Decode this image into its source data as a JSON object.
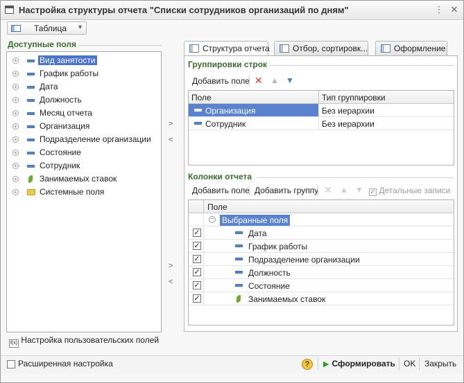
{
  "window": {
    "title": "Настройка структуры отчета \"Списки сотрудников организаций по дням\"",
    "menu_icon": "more-icon",
    "close_icon": "close-icon"
  },
  "view_mode": {
    "label": "Таблица",
    "icon": "table-icon"
  },
  "left": {
    "heading": "Доступные поля",
    "fields": [
      {
        "label": "Вид занятости",
        "icon": "field-icon",
        "expandable": true,
        "selected": true
      },
      {
        "label": "График работы",
        "icon": "field-icon",
        "expandable": true
      },
      {
        "label": "Дата",
        "icon": "field-icon",
        "expandable": true
      },
      {
        "label": "Должность",
        "icon": "field-icon",
        "expandable": true
      },
      {
        "label": "Месяц отчета",
        "icon": "field-icon",
        "expandable": true
      },
      {
        "label": "Организация",
        "icon": "field-icon",
        "expandable": true
      },
      {
        "label": "Подразделение организации",
        "icon": "field-icon",
        "expandable": true
      },
      {
        "label": "Состояние",
        "icon": "field-icon",
        "expandable": true
      },
      {
        "label": "Сотрудник",
        "icon": "field-icon",
        "expandable": true
      },
      {
        "label": "Занимаемых ставок",
        "icon": "resource-icon",
        "expandable": true
      },
      {
        "label": "Системные поля",
        "icon": "folder-icon",
        "expandable": true
      }
    ],
    "custom_fields_label": "Настройка пользовательских полей",
    "custom_fields_icon_text": "f(x)"
  },
  "transfer": {
    "add": ">",
    "remove": "<"
  },
  "tabs": [
    {
      "label": "Структура отчета",
      "active": true
    },
    {
      "label": "Отбор, сортировк..."
    },
    {
      "label": "Оформление"
    }
  ],
  "row_groups": {
    "heading": "Группировки строк",
    "add_field": "Добавить поле",
    "columns": [
      "Поле",
      "Тип группировки"
    ],
    "rows": [
      {
        "field": "Организация",
        "type": "Без иерархии",
        "selected": true
      },
      {
        "field": "Сотрудник",
        "type": "Без иерархии"
      }
    ]
  },
  "report_columns": {
    "heading": "Колонки отчета",
    "add_field": "Добавить поле",
    "add_group": "Добавить группу",
    "detail_records": "Детальные записи",
    "column_header": "Поле",
    "group_label": "Выбранные поля",
    "rows": [
      {
        "label": "Дата",
        "checked": true,
        "icon": "field-icon"
      },
      {
        "label": "График работы",
        "checked": true,
        "icon": "field-icon"
      },
      {
        "label": "Подразделение организации",
        "checked": true,
        "icon": "field-icon"
      },
      {
        "label": "Должность",
        "checked": true,
        "icon": "field-icon"
      },
      {
        "label": "Состояние",
        "checked": true,
        "icon": "field-icon"
      },
      {
        "label": "Занимаемых ставок",
        "checked": true,
        "icon": "resource-icon"
      }
    ]
  },
  "footer": {
    "extended": "Расширенная настройка",
    "help": "?",
    "generate": "Сформировать",
    "ok": "OK",
    "close": "Закрыть"
  }
}
